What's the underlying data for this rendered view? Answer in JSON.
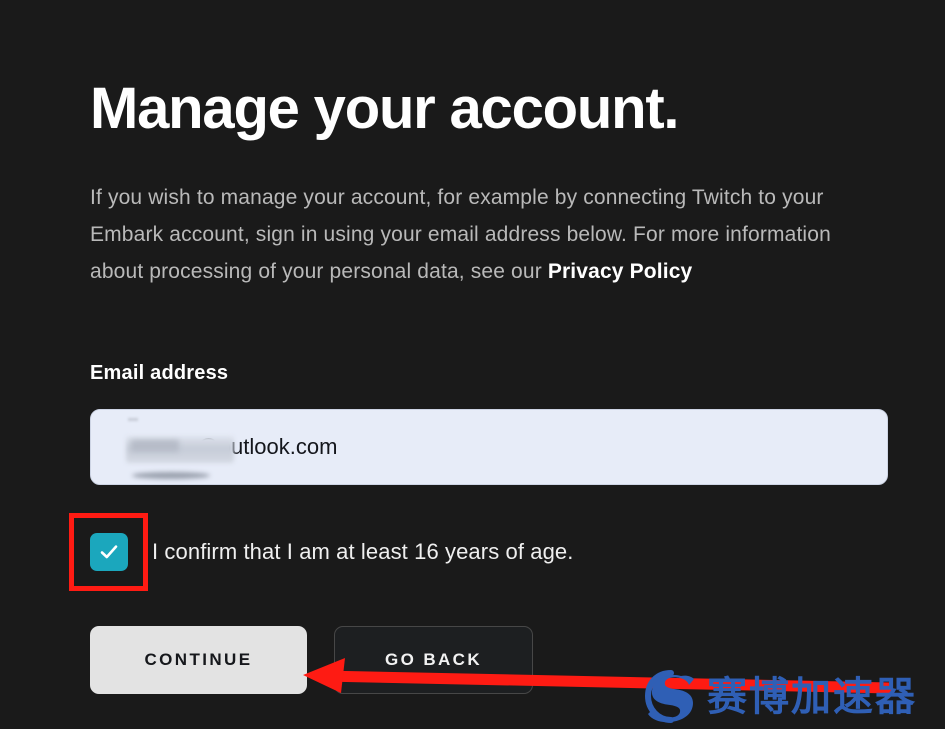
{
  "theme": {
    "background": "#1a1a1a",
    "text_primary": "#ffffff",
    "text_secondary": "#b9b9b9",
    "accent_checkbox": "#1ba7bd",
    "annotation_red": "#fe1b13",
    "input_background": "#e7ecf8",
    "watermark_blue": "#2f5fb5"
  },
  "page": {
    "heading": "Manage your account.",
    "intro_text_before_link": "If you wish to manage your account, for example by connecting Twitch to your Embark account, sign in using your email address below. For more information about processing of your personal data, see our ",
    "privacy_policy_link": "Privacy Policy"
  },
  "form": {
    "email_label": "Email address",
    "email_value": "@outlook.com",
    "email_placeholder": "Email address",
    "email_redacted": true,
    "consent_label": "I confirm that I am at least 16 years of age.",
    "consent_checked": true,
    "checkmark_icon": "check-icon"
  },
  "buttons": {
    "continue_label": "CONTINUE",
    "go_back_label": "GO BACK"
  },
  "annotations": {
    "highlight_target": "age-confirmation-checkbox",
    "arrow_points_to": "continue-button"
  },
  "watermark": {
    "text": "赛博加速器",
    "logo_icon": "cyber-s-logo-icon"
  }
}
